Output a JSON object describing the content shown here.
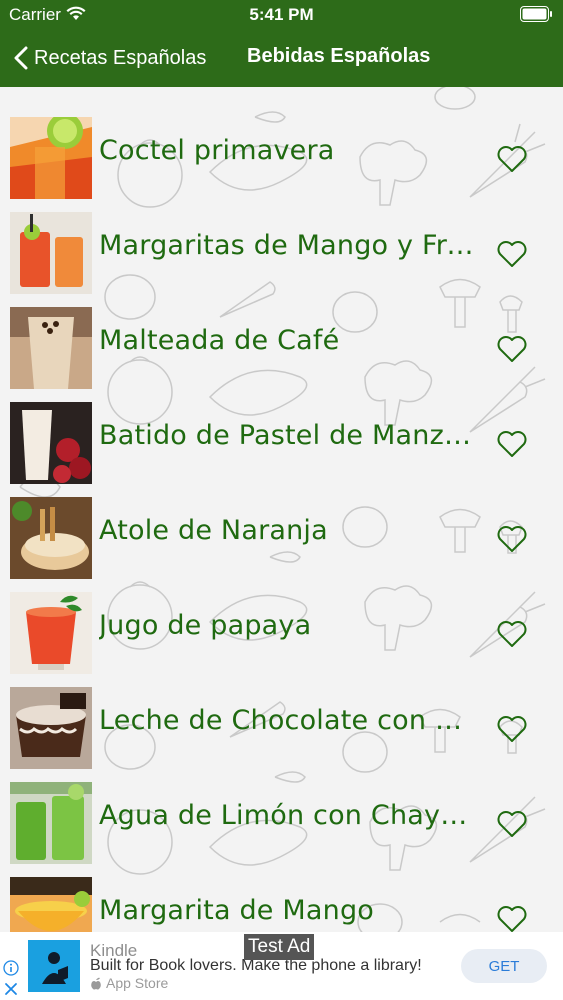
{
  "status_bar": {
    "carrier": "Carrier",
    "time": "5:41 PM"
  },
  "nav": {
    "back_label": "Recetas Españolas",
    "title": "Bebidas Españolas"
  },
  "colors": {
    "brand_green": "#2d6b19",
    "title_green": "#1f6a10"
  },
  "recipes": [
    {
      "title": "Coctel primavera",
      "favorite": false
    },
    {
      "title": "Margaritas de Mango y Fre...",
      "favorite": false
    },
    {
      "title": "Malteada de Café",
      "favorite": false
    },
    {
      "title": "Batido de Pastel de Manza...",
      "favorite": false
    },
    {
      "title": "Atole de Naranja",
      "favorite": false
    },
    {
      "title": "Jugo de papaya",
      "favorite": false
    },
    {
      "title": "Leche de Chocolate con N...",
      "favorite": false
    },
    {
      "title": "Agua de Limón con Chaya...",
      "favorite": false
    },
    {
      "title": "Margarita de Mango",
      "favorite": false
    }
  ],
  "ad": {
    "label": "Test Ad",
    "app_name": "Kindle",
    "text": "Built for Book lovers. Make the phone a library!",
    "store": "App Store",
    "cta": "GET"
  }
}
